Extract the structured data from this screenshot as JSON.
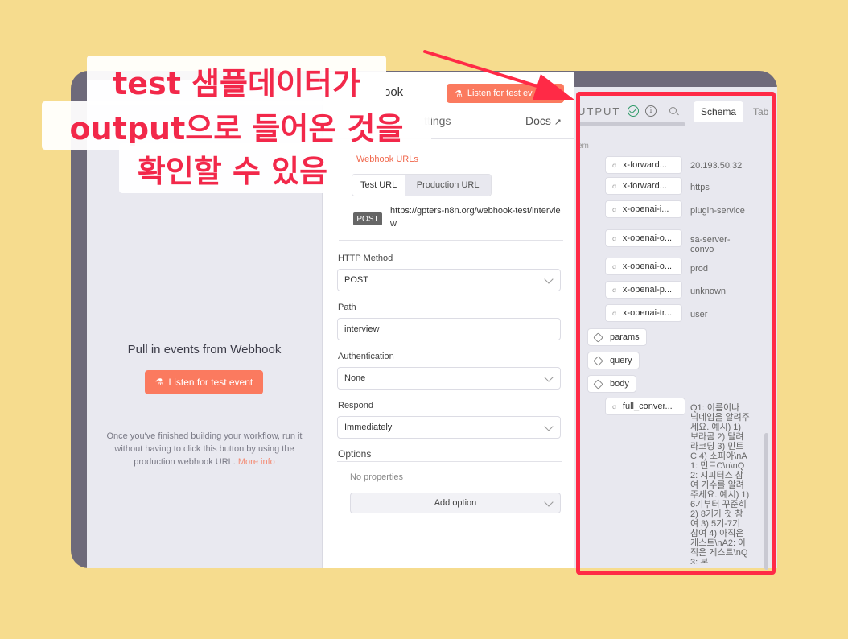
{
  "left_panel": {
    "title": "Pull in events from Webhook",
    "listen_button": "Listen for test event",
    "hint": "Once you've finished building your workflow, run it without having to click this button by using the production webhook URL.",
    "more_info": "More info"
  },
  "center_panel": {
    "title_partial": "ook",
    "listen_button_partial": "Listen for test ev",
    "tab_settings": "ttings",
    "docs": "Docs",
    "webhook_urls_partial": "Webhook URLs",
    "url_tabs": [
      "Test URL",
      "Production URL"
    ],
    "method_badge": "POST",
    "url": "https://gpters-n8n.org/webhook-test/interview",
    "fields": {
      "http_method": {
        "label": "HTTP Method",
        "value": "POST"
      },
      "path": {
        "label": "Path",
        "value": "interview"
      },
      "authentication": {
        "label": "Authentication",
        "value": "None"
      },
      "respond": {
        "label": "Respond",
        "value": "Immediately"
      }
    },
    "options_label": "Options",
    "no_properties": "No properties",
    "add_option": "Add option"
  },
  "output_panel": {
    "label_partial": "UTPUT",
    "tabs": [
      "Schema",
      "Tab"
    ],
    "item_label_partial": "em",
    "rows": [
      {
        "key": "x-forward...",
        "value": "20.193.50.32"
      },
      {
        "key": "x-forward...",
        "value": "https"
      },
      {
        "key": "x-openai-i...",
        "value": "plugin-service"
      },
      {
        "key": "x-openai-o...",
        "value": "sa-server-convo"
      },
      {
        "key": "x-openai-o...",
        "value": "prod"
      },
      {
        "key": "x-openai-p...",
        "value": "unknown"
      },
      {
        "key": "x-openai-tr...",
        "value": "user"
      }
    ],
    "objects": [
      "params",
      "query",
      "body"
    ],
    "body_field": {
      "key": "full_conver...",
      "value": "Q1: 이름이나 닉네임을 알려주세요. 예시) 1) 보라곰 2) 달려라코딩 3) 민트C 4) 소피아\\nA1: 민트C\\n\\nQ2: 지피터스 참여 기수를 알려주세요. 예시) 1) 6기부터 꾸준히 2) 8기가 첫 참여 3) 5기-7기 참여 4) 아직은 게스트\\nA2: 아직은 게스트\\nQ3: 본"
    }
  },
  "annotation": {
    "line1": "test 샘플데이터가",
    "line2": "output으로 들어온 것을",
    "line3": "확인할 수 있음"
  },
  "colors": {
    "background": "#f6dc8e",
    "accent": "#fb7a5f",
    "annotation_red": "#ff2a46"
  }
}
